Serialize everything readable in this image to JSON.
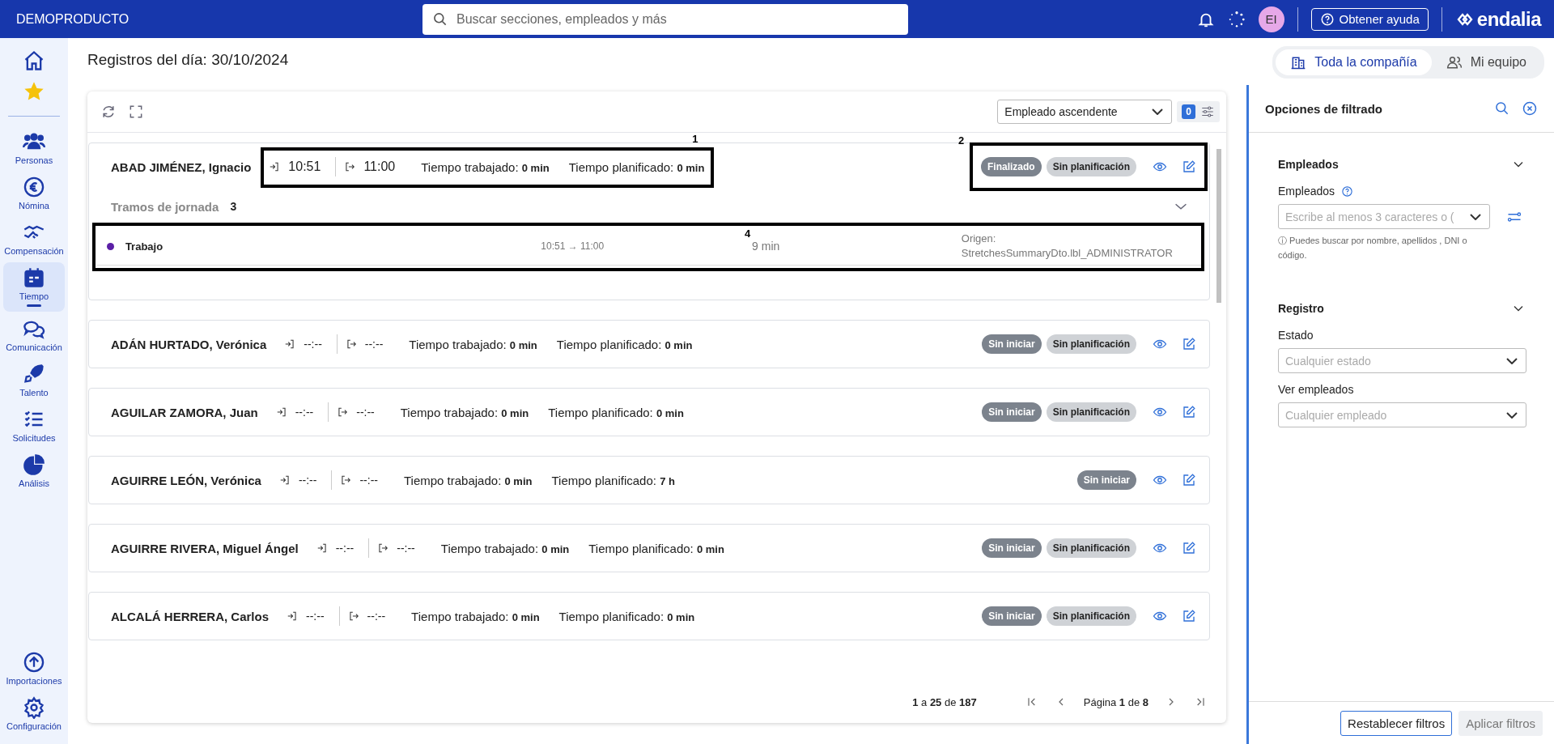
{
  "header": {
    "brand": "DEMOPRODUCTO",
    "search": {
      "placeholder": "Buscar secciones, empleados y más"
    },
    "avatar": "EI",
    "help": "Obtener ayuda",
    "logo": "endalia"
  },
  "sidebar": {
    "items": [
      {
        "label": "Personas",
        "selected": false
      },
      {
        "label": "Nómina",
        "selected": false
      },
      {
        "label": "Compensación",
        "selected": false
      },
      {
        "label": "Tiempo",
        "selected": true
      },
      {
        "label": "Comunicación",
        "selected": false
      },
      {
        "label": "Talento",
        "selected": false
      },
      {
        "label": "Solicitudes",
        "selected": false
      },
      {
        "label": "Análisis",
        "selected": false
      }
    ],
    "footer_items": [
      {
        "label": "Importaciones",
        "selected": false
      },
      {
        "label": "Configuración",
        "selected": false
      }
    ]
  },
  "page_title": "Registros del día: 30/10/2024",
  "scope_tabs": [
    {
      "label": "Toda la compañía",
      "selected": true
    },
    {
      "label": "Mi equipo",
      "selected": false
    }
  ],
  "toolbar": {
    "sort": "Empleado ascendente",
    "filter_count": "0"
  },
  "rows": [
    {
      "name": "ABAD JIMÉNEZ, Ignacio",
      "in": "10:51",
      "out": "11:00",
      "worked": "Tiempo trabajado: **0 min**",
      "planned": "Tiempo planificado: **0 min**",
      "badges": [
        {
          "label": "Finalizado",
          "kind": "status"
        },
        {
          "label": "Sin planificación",
          "kind": "plan"
        }
      ],
      "expanded": true,
      "section": "Tramos de jornada",
      "stretches": [
        {
          "type": "Trabajo",
          "color": "#5b1fa6",
          "range": "10:51 → 11:00",
          "duration": "9 min",
          "origin": "Origen: StretchesSummaryDto.lbl_ADMINISTRATOR"
        }
      ]
    },
    {
      "name": "ADÁN HURTADO, Verónica",
      "in": "--:--",
      "out": "--:--",
      "worked": "Tiempo trabajado: **0 min**",
      "planned": "Tiempo planificado: **0 min**",
      "badges": [
        {
          "label": "Sin iniciar",
          "kind": "status"
        },
        {
          "label": "Sin planificación",
          "kind": "plan"
        }
      ],
      "expanded": false
    },
    {
      "name": "AGUILAR ZAMORA, Juan",
      "in": "--:--",
      "out": "--:--",
      "worked": "Tiempo trabajado: **0 min**",
      "planned": "Tiempo planificado: **0 min**",
      "badges": [
        {
          "label": "Sin iniciar",
          "kind": "status"
        },
        {
          "label": "Sin planificación",
          "kind": "plan"
        }
      ],
      "expanded": false
    },
    {
      "name": "AGUIRRE LEÓN, Verónica",
      "in": "--:--",
      "out": "--:--",
      "worked": "Tiempo trabajado: **0 min**",
      "planned": "Tiempo planificado: **7 h**",
      "badges": [
        {
          "label": "Sin iniciar",
          "kind": "status"
        }
      ],
      "expanded": false
    },
    {
      "name": "AGUIRRE RIVERA, Miguel Ángel",
      "in": "--:--",
      "out": "--:--",
      "worked": "Tiempo trabajado: **0 min**",
      "planned": "Tiempo planificado: **0 min**",
      "badges": [
        {
          "label": "Sin iniciar",
          "kind": "status"
        },
        {
          "label": "Sin planificación",
          "kind": "plan"
        }
      ],
      "expanded": false
    },
    {
      "name": "ALCALÁ HERRERA, Carlos",
      "in": "--:--",
      "out": "--:--",
      "worked": "Tiempo trabajado: **0 min**",
      "planned": "Tiempo planificado: **0 min**",
      "badges": [
        {
          "label": "Sin iniciar",
          "kind": "status"
        },
        {
          "label": "Sin planificación",
          "kind": "plan"
        }
      ],
      "expanded": false
    }
  ],
  "annotations": [
    {
      "number": "1",
      "kind": "times"
    },
    {
      "number": "2",
      "kind": "badges"
    },
    {
      "number": "3",
      "kind": "section"
    },
    {
      "number": "4",
      "kind": "stretch"
    }
  ],
  "pagination": {
    "range": "**1** a **25** de **187**",
    "page": "Página **1** de **8**"
  },
  "filters": {
    "title": "Opciones de filtrado",
    "sections": [
      {
        "title": "Empleados",
        "expanded": true,
        "fields": [
          {
            "label": "Empleados",
            "placeholder": "Escribe al menos 3 caracteres o (",
            "help": "ⓘ Puedes buscar por nombre, apellidos , DNI o código.",
            "kind": "search"
          }
        ]
      },
      {
        "title": "Registro",
        "expanded": true,
        "fields": [
          {
            "label": "Estado",
            "placeholder": "Cualquier estado",
            "kind": "select"
          },
          {
            "label": "Ver empleados",
            "placeholder": "Cualquier empleado",
            "kind": "select"
          }
        ]
      }
    ],
    "buttons": [
      {
        "label": "Restablecer filtros",
        "disabled": false
      },
      {
        "label": "Aplicar filtros",
        "disabled": true
      }
    ]
  }
}
